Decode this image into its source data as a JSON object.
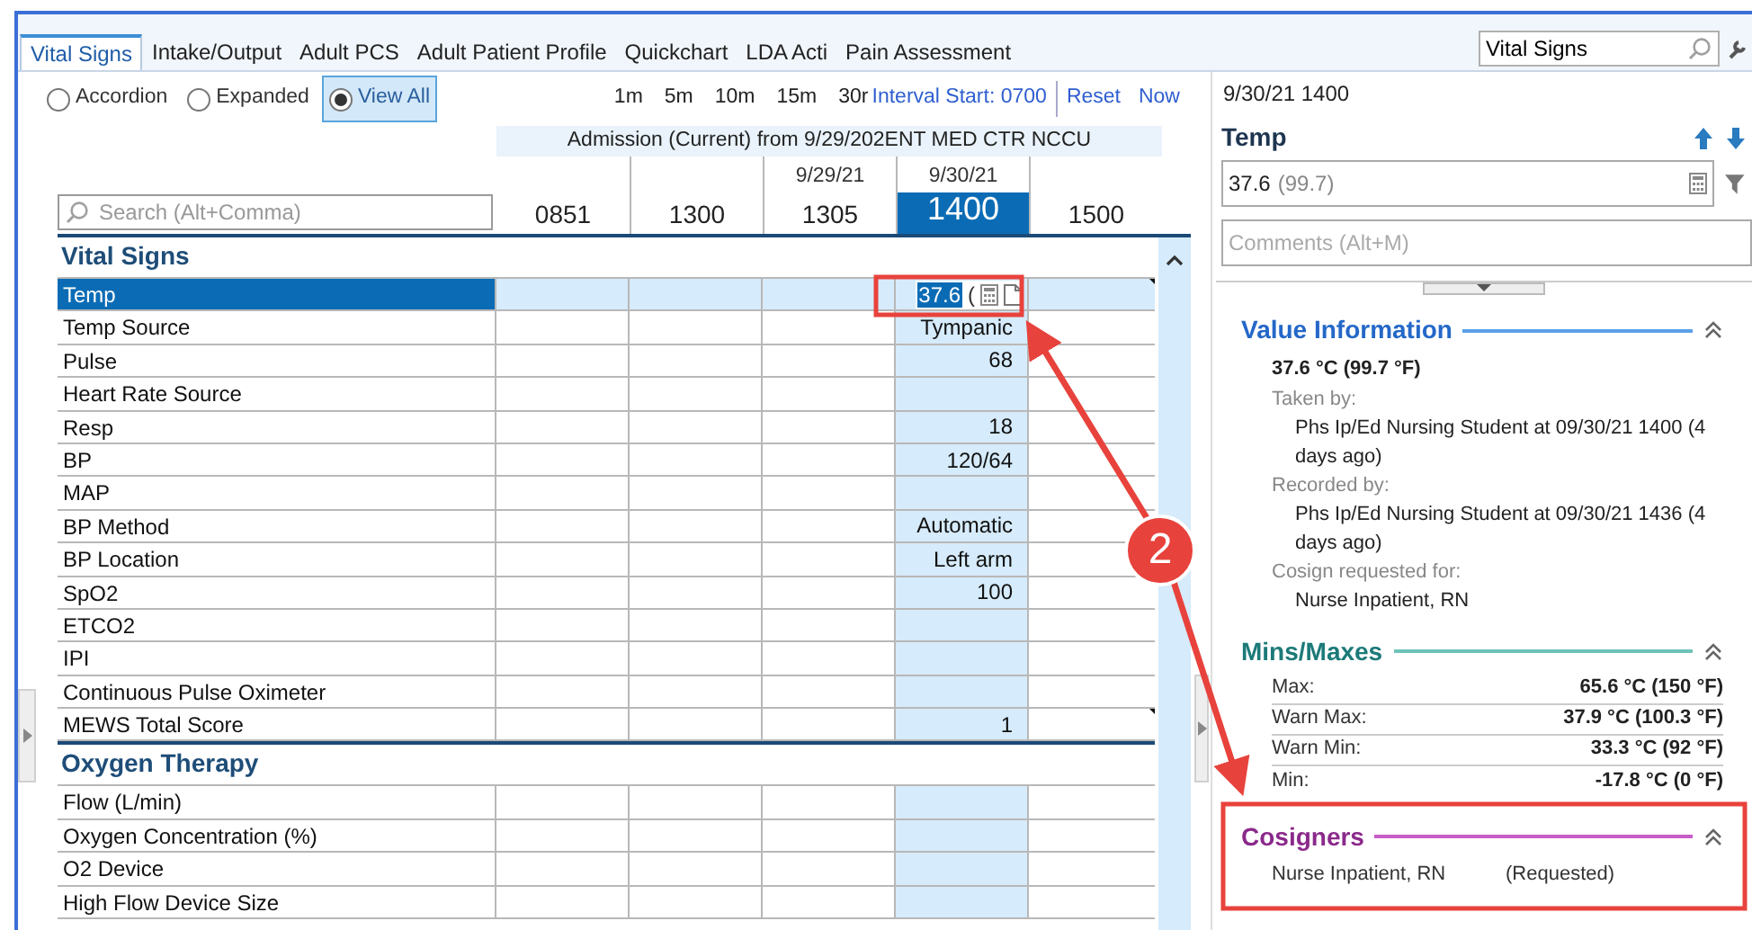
{
  "tabs": [
    {
      "label": "Vital Signs",
      "selected": true
    },
    {
      "label": "Intake/Output",
      "selected": false
    },
    {
      "label": "Adult PCS",
      "selected": false
    },
    {
      "label": "Adult Patient Profile",
      "selected": false
    },
    {
      "label": "Quickchart",
      "selected": false
    },
    {
      "label": "LDA Acti",
      "selected": false
    },
    {
      "label": "Pain Assessment",
      "selected": false
    }
  ],
  "form_search": {
    "value": "Vital Signs"
  },
  "view_modes": [
    {
      "label": "Accordion",
      "selected": false
    },
    {
      "label": "Expanded",
      "selected": false
    },
    {
      "label": "View All",
      "selected": true
    }
  ],
  "intervals": [
    "1m",
    "5m",
    "10m",
    "15m",
    "30r"
  ],
  "interval_start": "Interval Start: 0700",
  "reset": "Reset",
  "now": "Now",
  "admission": "Admission (Current) from 9/29/202",
  "department": "ENT MED CTR NCCU",
  "row_search": {
    "placeholder": "Search (Alt+Comma)"
  },
  "columns": [
    {
      "time": "0851",
      "selected": false
    },
    {
      "time": "1300",
      "selected": false
    },
    {
      "date": "9/29/21",
      "time": "1305",
      "selected": false
    },
    {
      "date": "9/30/21",
      "time": "1400",
      "selected": true
    },
    {
      "time": "1500",
      "selected": false
    }
  ],
  "sections": [
    {
      "title": "Vital Signs",
      "rows": [
        {
          "label": "Temp",
          "selected": true,
          "editing": true,
          "value": "37.6",
          "suffix": "(",
          "comment_mark": true
        },
        {
          "label": "Temp Source",
          "selected": false,
          "value": "Tympanic"
        },
        {
          "label": "Pulse",
          "selected": false,
          "value": "68"
        },
        {
          "label": "Heart Rate Source",
          "selected": false
        },
        {
          "label": "Resp",
          "selected": false,
          "value": "18"
        },
        {
          "label": "BP",
          "selected": false,
          "value": "120/64"
        },
        {
          "label": "MAP",
          "selected": false
        },
        {
          "label": "BP Method",
          "selected": false,
          "value": "Automatic"
        },
        {
          "label": "BP Location",
          "selected": false,
          "value": "Left arm"
        },
        {
          "label": "SpO2",
          "selected": false,
          "value": "100"
        },
        {
          "label": "ETCO2",
          "selected": false
        },
        {
          "label": "IPI",
          "selected": false
        },
        {
          "label": "Continuous Pulse Oximeter",
          "selected": false
        },
        {
          "label": "MEWS Total Score",
          "selected": false,
          "value": "1",
          "comment_mark": true
        }
      ]
    },
    {
      "title": "Oxygen Therapy",
      "rows": [
        {
          "label": "Flow (L/min)",
          "selected": false
        },
        {
          "label": "Oxygen Concentration (%)",
          "selected": false
        },
        {
          "label": "O2 Device",
          "selected": false
        },
        {
          "label": "High Flow Device Size",
          "selected": false
        }
      ]
    }
  ],
  "detail": {
    "datetime": "9/30/21 1400",
    "title": "Temp",
    "value": "37.6",
    "converted": "(99.7)",
    "comments": {
      "placeholder": "Comments (Alt+M)"
    }
  },
  "value_information": {
    "title": "Value Information",
    "summary": "37.6 °C (99.7 °F)",
    "entries": [
      {
        "label": "Taken by:",
        "text": "Phs Ip/Ed Nursing Student at 09/30/21 1400 (4 days ago)"
      },
      {
        "label": "Recorded by:",
        "text": "Phs Ip/Ed Nursing Student at 09/30/21 1436 (4 days ago)"
      },
      {
        "label": "Cosign requested for:",
        "text": "Nurse Inpatient, RN"
      }
    ]
  },
  "mins_maxes": {
    "title": "Mins/Maxes",
    "rows": [
      {
        "label": "Max:",
        "value": "65.6 °C (150 °F)"
      },
      {
        "label": "Warn Max:",
        "value": "37.9 °C (100.3 °F)"
      },
      {
        "label": "Warn Min:",
        "value": "33.3 °C (92 °F)"
      },
      {
        "label": "Min:",
        "value": "-17.8 °C (0 °F)"
      }
    ]
  },
  "cosigners": {
    "title": "Cosigners",
    "rows": [
      {
        "name": "Nurse Inpatient, RN",
        "status": "(Requested)"
      }
    ]
  },
  "annotation": {
    "badge": "2"
  }
}
